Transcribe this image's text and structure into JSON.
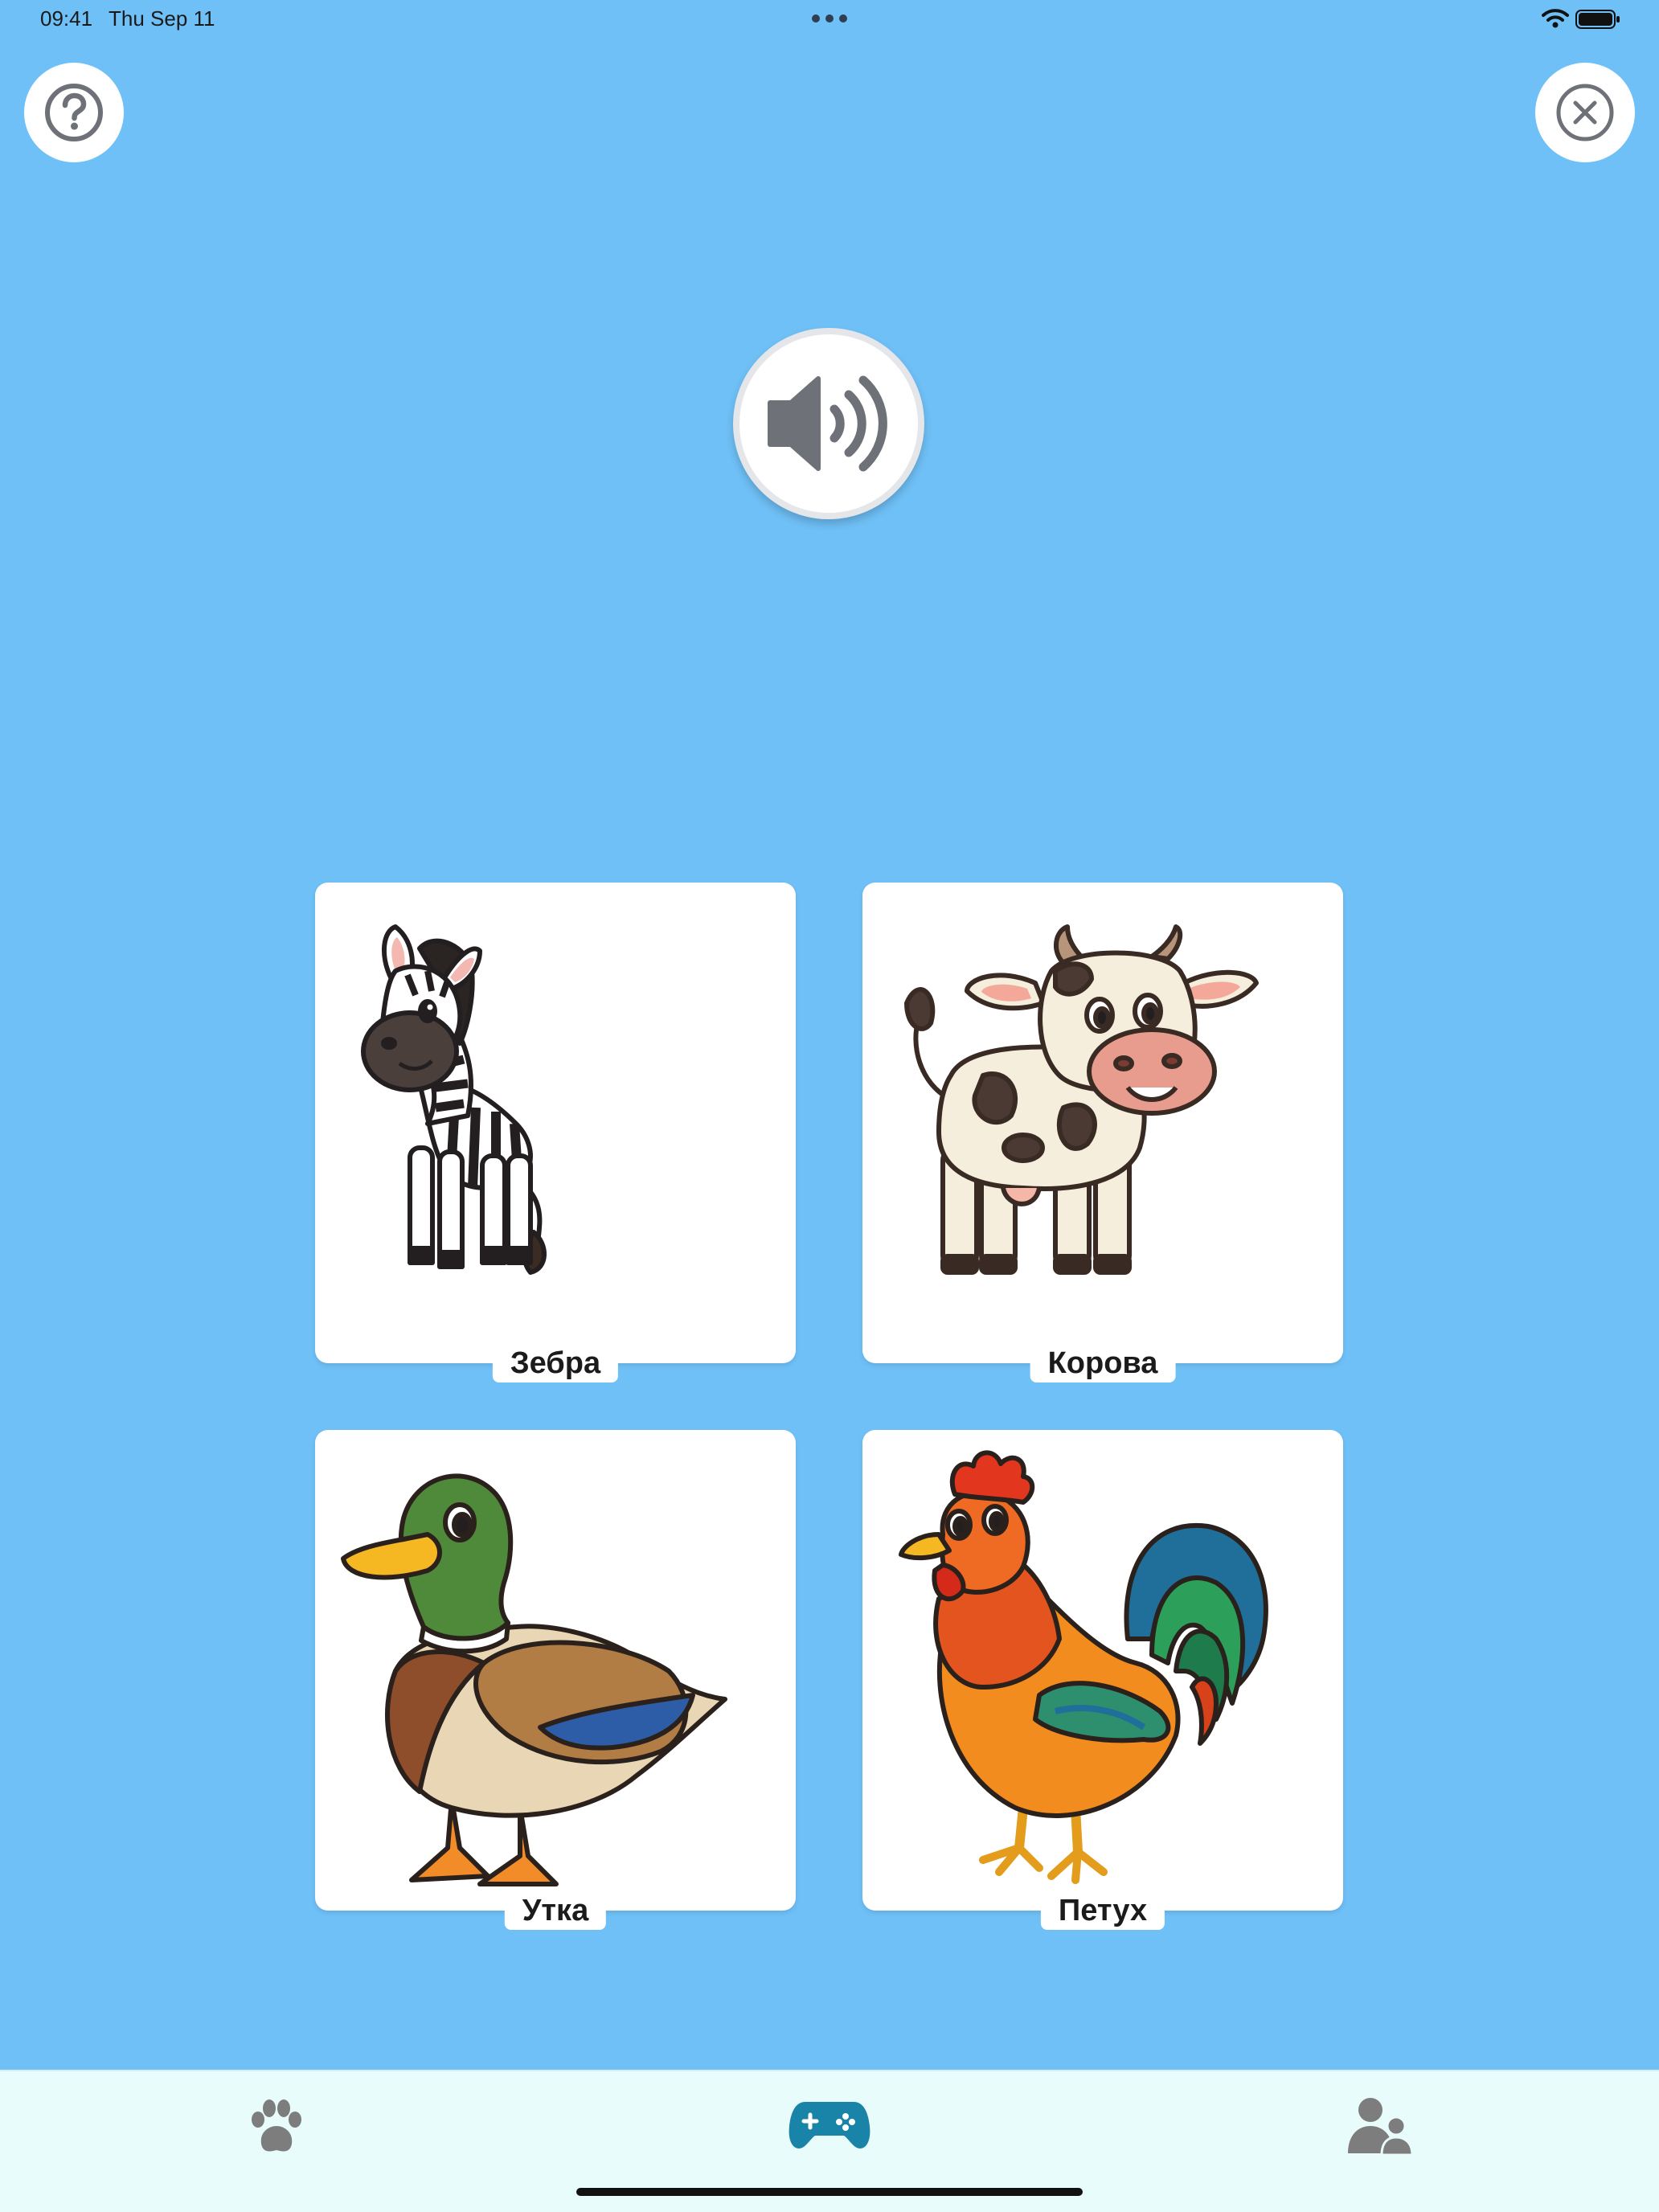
{
  "status_bar": {
    "time": "09:41",
    "date": "Thu Sep 11"
  },
  "header": {
    "help_icon": "question-circle-icon",
    "close_icon": "close-circle-icon",
    "speaker_icon": "speaker-volume-icon"
  },
  "cards": [
    {
      "label": "Зебра",
      "image": "zebra"
    },
    {
      "label": "Корова",
      "image": "cow"
    },
    {
      "label": "Утка",
      "image": "duck"
    },
    {
      "label": "Петух",
      "image": "rooster"
    }
  ],
  "tabbar": {
    "tabs": [
      {
        "icon": "paw-icon",
        "selected": false
      },
      {
        "icon": "gamepad-icon",
        "selected": true
      },
      {
        "icon": "users-icon",
        "selected": false
      }
    ]
  },
  "colors": {
    "background": "#6FC0F7",
    "tabbar_background": "#E8FCFC",
    "tab_active": "#1A84A8",
    "tab_inactive": "#7D7D7D",
    "icon_gray": "#6E7177"
  }
}
